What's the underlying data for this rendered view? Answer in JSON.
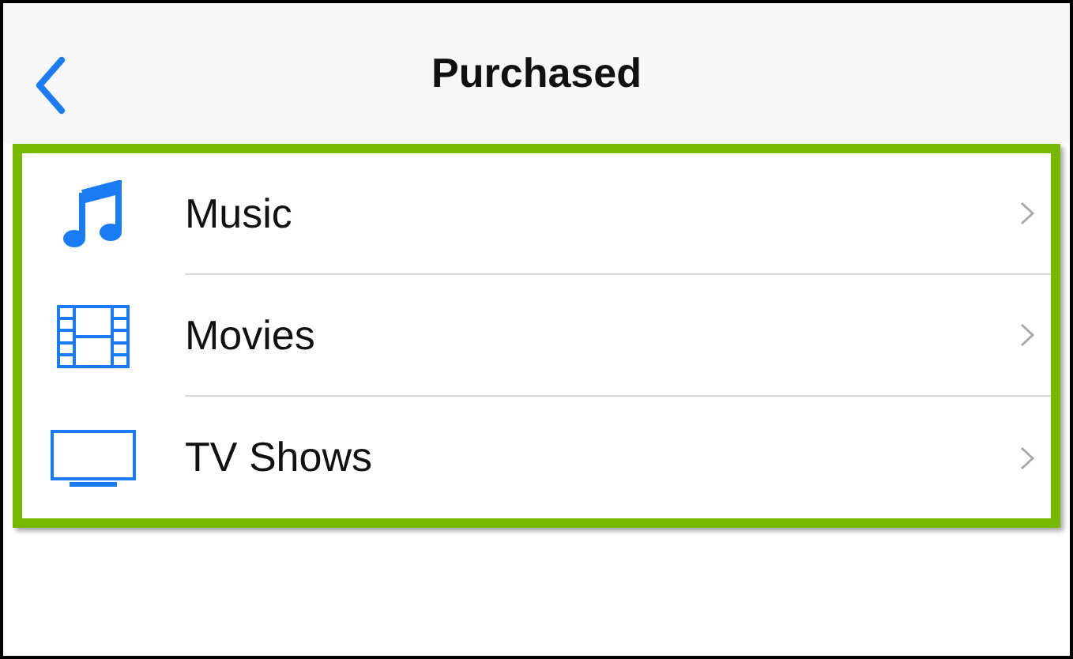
{
  "nav_bar": {
    "title": "Purchased"
  },
  "items": [
    {
      "kind": "music",
      "label": "Music"
    },
    {
      "kind": "movies",
      "label": "Movies"
    },
    {
      "kind": "tv",
      "label": "TV Shows"
    }
  ]
}
